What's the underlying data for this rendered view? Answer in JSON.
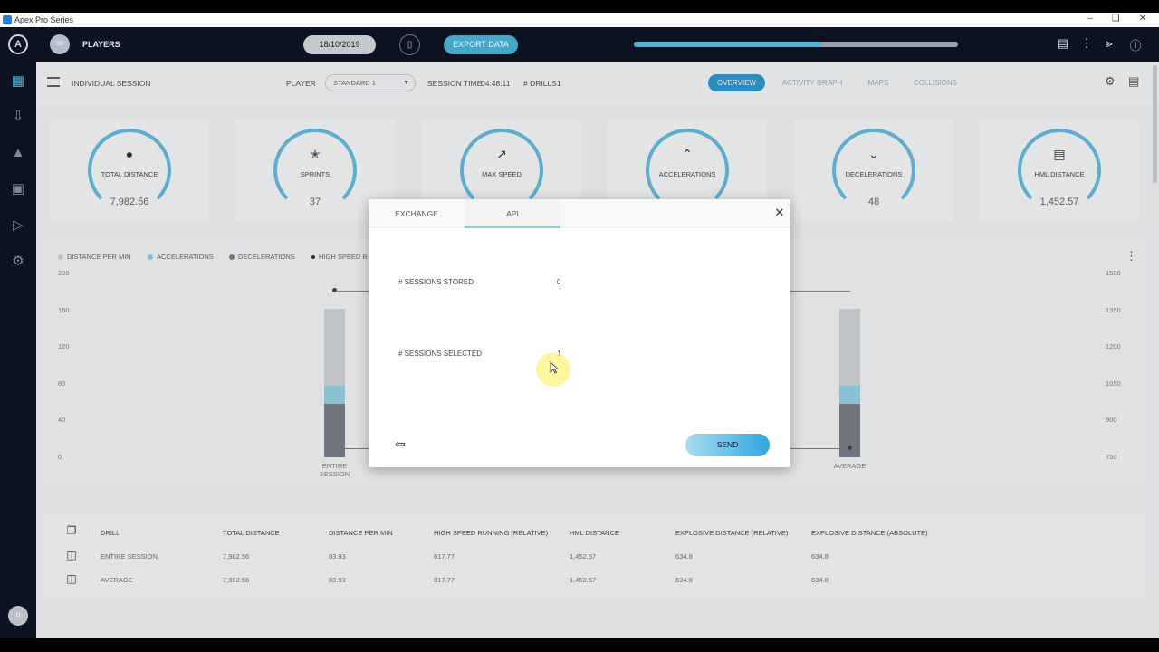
{
  "window": {
    "title": "Apex Pro Series",
    "controls": [
      "minimize-icon",
      "restore-icon",
      "close-icon"
    ]
  },
  "topbar": {
    "logo": "A",
    "avatar": "SD",
    "players_label": "PLAYERS",
    "date": "18/10/2019",
    "export_label": "EXPORT DATA",
    "progress_fraction": 0.58,
    "icons": [
      "chart-icon",
      "more-vertical-icon",
      "share-icon",
      "info-icon"
    ]
  },
  "sidebar": {
    "icons": [
      "dashboard-icon",
      "download-icon",
      "shirt-icon",
      "calendar-icon",
      "play-icon",
      "settings-icon"
    ],
    "avatar": "D"
  },
  "session_header": {
    "title": "INDIVIDUAL SESSION",
    "player_label": "PLAYER",
    "player_value": "STANDARD 1",
    "session_time_label": "SESSION TIME",
    "session_time_value": "04:48:11",
    "drills_label": "# DRILLS",
    "drills_value": "1",
    "tabs": [
      {
        "label": "OVERVIEW",
        "active": true
      },
      {
        "label": "ACTIVITY GRAPH",
        "active": false
      },
      {
        "label": "MAPS",
        "active": false
      },
      {
        "label": "COLLISIONS",
        "active": false
      }
    ]
  },
  "kpis": [
    {
      "name": "TOTAL DISTANCE",
      "value": "7,982.56",
      "icon": "location-pin-icon"
    },
    {
      "name": "SPRINTS",
      "value": "37",
      "icon": "runner-icon"
    },
    {
      "name": "MAX SPEED",
      "value": "",
      "icon": "trend-up-icon"
    },
    {
      "name": "ACCELERATIONS",
      "value": "",
      "icon": "chevron-up-icon"
    },
    {
      "name": "DECELERATIONS",
      "value": "48",
      "icon": "chevron-down-icon"
    },
    {
      "name": "HML DISTANCE",
      "value": "1,452.57",
      "icon": "bar-chart-icon"
    }
  ],
  "chart_data": {
    "type": "bar",
    "categories": [
      "ENTIRE SESSION",
      "AVERAGE"
    ],
    "legend": [
      {
        "name": "DISTANCE PER MIN",
        "color": "#cfd2d6"
      },
      {
        "name": "ACCELERATIONS",
        "color": "#8ecfe4"
      },
      {
        "name": "DECELERATIONS",
        "color": "#6f7380"
      },
      {
        "name": "HIGH SPEED R",
        "color": "#222222"
      }
    ],
    "y_left_ticks": [
      "200",
      "160",
      "120",
      "80",
      "40",
      "0"
    ],
    "y_right_ticks": [
      "1500",
      "1350",
      "1200",
      "1050",
      "900",
      "750"
    ],
    "ylim": [
      0,
      200
    ],
    "ylim_right": [
      750,
      1500
    ],
    "series": [
      {
        "name": "DISTANCE PER MIN",
        "values": [
          83.93,
          83.93
        ]
      },
      {
        "name": "ACCELERATIONS",
        "values": [
          20,
          20
        ]
      },
      {
        "name": "DECELERATIONS",
        "values": [
          58,
          58
        ]
      }
    ],
    "line_series": {
      "name": "HIGH SPEED R",
      "points": [
        1430,
        787
      ]
    },
    "legend_position": "top-left"
  },
  "table": {
    "headers": [
      "DRILL",
      "TOTAL DISTANCE",
      "DISTANCE PER MIN",
      "HIGH SPEED RUNNING (RELATIVE)",
      "HML DISTANCE",
      "EXPLOSIVE DISTANCE (RELATIVE)",
      "EXPLOSIVE DISTANCE (ABSOLUTE)"
    ],
    "rows": [
      [
        "ENTIRE SESSION",
        "7,982.56",
        "83.93",
        "817.77",
        "1,452.57",
        "634.8",
        "634.8"
      ],
      [
        "AVERAGE",
        "7,982.56",
        "83.93",
        "817.77",
        "1,452.57",
        "634.8",
        "634.8"
      ]
    ]
  },
  "modal": {
    "tabs": [
      {
        "label": "EXCHANGE",
        "active": false
      },
      {
        "label": "API",
        "active": true
      }
    ],
    "sessions_stored_label": "# SESSIONS STORED",
    "sessions_stored_value": "0",
    "sessions_selected_label": "# SESSIONS SELECTED",
    "sessions_selected_value": "1",
    "send_label": "SEND"
  }
}
